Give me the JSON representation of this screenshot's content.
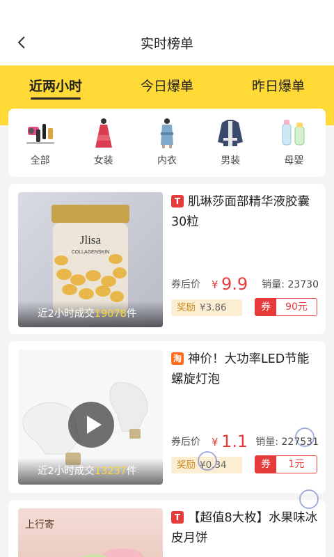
{
  "header": {
    "title": "实时榜单",
    "back_icon": "chevron-left-icon"
  },
  "tabs": [
    {
      "label": "近两小时",
      "active": true
    },
    {
      "label": "今日爆单",
      "active": false
    },
    {
      "label": "昨日爆单",
      "active": false
    }
  ],
  "categories": [
    {
      "label": "全部",
      "icon": "appliances-icon"
    },
    {
      "label": "女装",
      "icon": "dress-icon"
    },
    {
      "label": "内衣",
      "icon": "sleepwear-icon"
    },
    {
      "label": "男装",
      "icon": "jacket-icon"
    },
    {
      "label": "母婴",
      "icon": "baby-bottle-icon"
    }
  ],
  "products": [
    {
      "platform": "T",
      "platform_icon": "tmall-icon",
      "name": "肌琳莎面部精华液胶囊30粒",
      "price_label": "券后价",
      "currency": "¥",
      "price": "9.9",
      "sold_label": "销量:",
      "sold": "23730",
      "reward_label": "奖励",
      "reward_value": "¥3.86",
      "coupon_label": "券",
      "coupon_value": "90元",
      "sales_prefix": "近2小时成交",
      "sales_count": "19078",
      "sales_unit": "件",
      "image_text": "Jlisa COLLAGENSKIN"
    },
    {
      "platform": "淘",
      "platform_icon": "taobao-icon",
      "name": "神价！大功率LED节能螺旋灯泡",
      "price_label": "券后价",
      "currency": "¥",
      "price": "1.1",
      "sold_label": "销量:",
      "sold": "227531",
      "reward_label": "奖励",
      "reward_value": "¥0.34",
      "coupon_label": "券",
      "coupon_value": "1元",
      "sales_prefix": "近2小时成交",
      "sales_count": "13237",
      "sales_unit": "件"
    },
    {
      "platform": "T",
      "platform_icon": "tmall-icon",
      "name": "【超值8大枚】水果味冰皮月饼",
      "image_text": "上行寄"
    }
  ],
  "colors": {
    "accent_yellow": "#ffd935",
    "price_red": "#e53b3b",
    "reward_gold": "#c98a19"
  }
}
